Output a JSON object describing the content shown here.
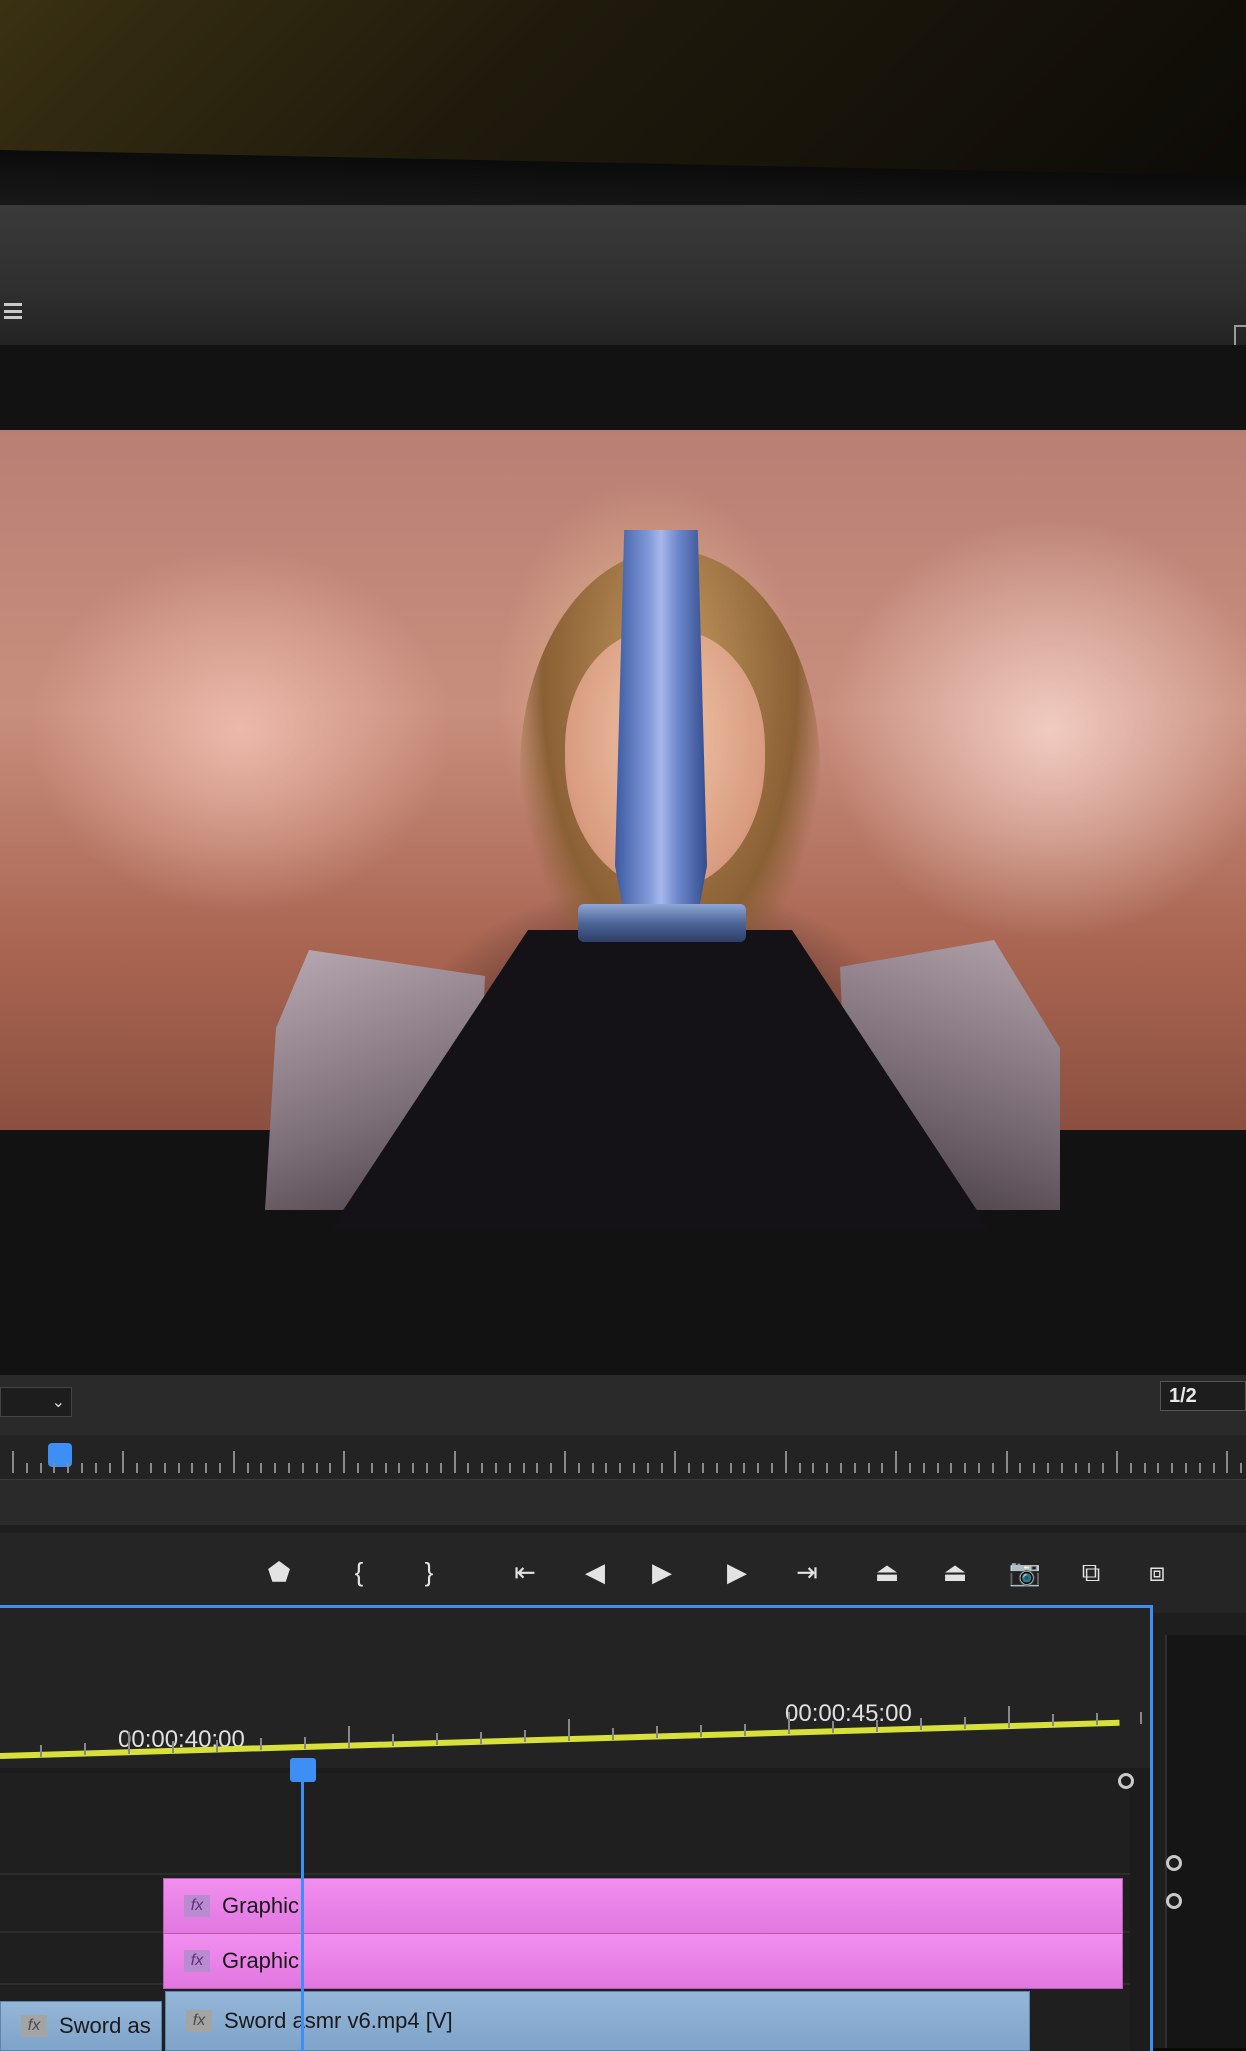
{
  "monitor": {
    "fraction_label": "1/2"
  },
  "transport": {
    "buttons": [
      {
        "name": "add-marker-button",
        "glyph": "⬟"
      },
      {
        "name": "mark-in-button",
        "glyph": "{"
      },
      {
        "name": "mark-out-button",
        "glyph": "}"
      },
      {
        "name": "go-to-in-button",
        "glyph": "⇤"
      },
      {
        "name": "step-back-button",
        "glyph": "◀"
      },
      {
        "name": "play-button",
        "glyph": "▶"
      },
      {
        "name": "step-forward-button",
        "glyph": "▶"
      },
      {
        "name": "go-to-out-button",
        "glyph": "⇥"
      },
      {
        "name": "lift-button",
        "glyph": "⏏"
      },
      {
        "name": "extract-button",
        "glyph": "⏏"
      },
      {
        "name": "export-frame-button",
        "glyph": "📷"
      },
      {
        "name": "insert-button",
        "glyph": "⧉"
      },
      {
        "name": "overwrite-button",
        "glyph": "⧈"
      }
    ]
  },
  "timeline": {
    "timecode_1": "00:00:40:00",
    "timecode_2": "00:00:45:00",
    "clips": {
      "graphic_1": "Graphic",
      "graphic_2": "Graphic",
      "video_main": "Sword asmr v6.mp4 [V]",
      "video_left": "Sword as"
    },
    "fx_label": "fx"
  },
  "colors": {
    "accent": "#3d8ff5",
    "graphic_clip": "#e078e0",
    "video_clip": "#7fa3c9",
    "audio_clip": "#47a352",
    "work_area": "#d8e03a"
  }
}
